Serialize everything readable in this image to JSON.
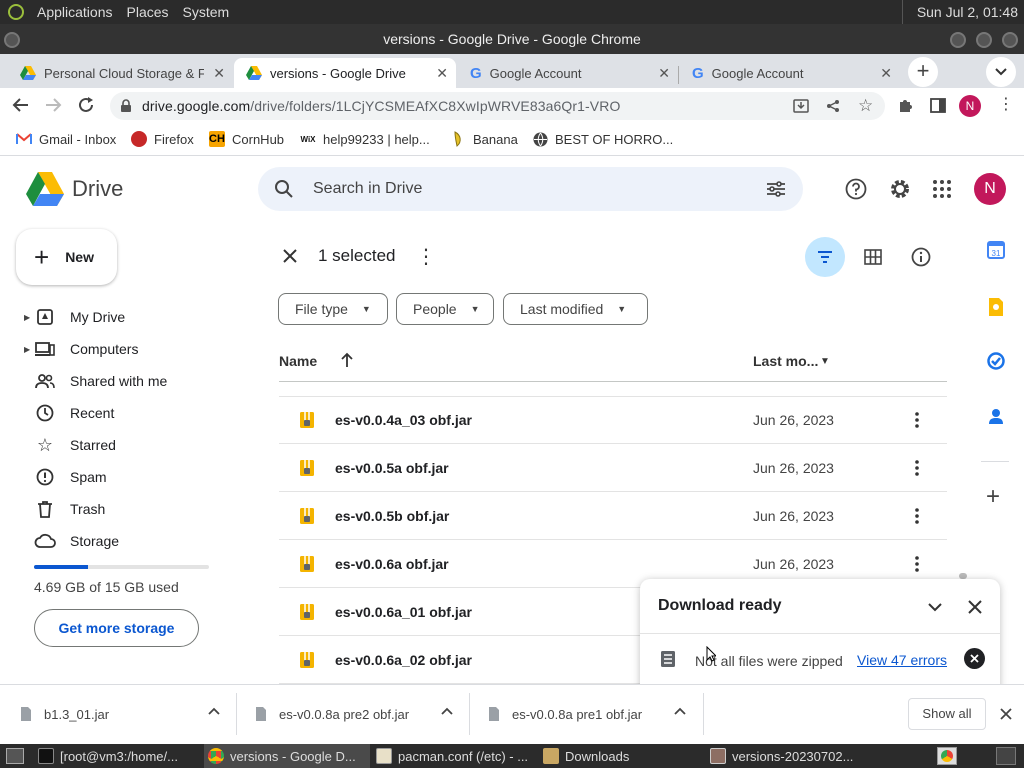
{
  "system": {
    "menus": [
      "Applications",
      "Places",
      "System"
    ],
    "clock": "Sun Jul  2, 01:48"
  },
  "window": {
    "title": "versions - Google Drive - Google Chrome"
  },
  "tabs": [
    {
      "label": "Personal Cloud Storage & F",
      "icon": "drive-icon"
    },
    {
      "label": "versions - Google Drive",
      "icon": "drive-icon",
      "active": true
    },
    {
      "label": "Google Account",
      "icon": "google-icon"
    },
    {
      "label": "Google Account",
      "icon": "google-icon"
    }
  ],
  "omnibox": {
    "host": "drive.google.com",
    "path": "/drive/folders/1LCjYCSMEAfXC8XwIpWRVE83a6Qr1-VRO"
  },
  "profile_initial": "N",
  "bookmarks": [
    {
      "label": "Gmail - Inbox",
      "icon": "gmail-icon"
    },
    {
      "label": "Firefox",
      "icon": "firefox-icon"
    },
    {
      "label": "CornHub",
      "icon": "ch-icon",
      "badge": "CH"
    },
    {
      "label": "help99233 | help...",
      "icon": "wix-icon",
      "badge": "WiX"
    },
    {
      "label": "Banana",
      "icon": "banana-icon"
    },
    {
      "label": "BEST OF HORRO...",
      "icon": "globe-icon"
    }
  ],
  "drive": {
    "logo_text": "Drive",
    "search_placeholder": "Search in Drive",
    "new_label": "New",
    "nav": [
      {
        "label": "My Drive",
        "icon": "my-drive-icon",
        "expandable": true
      },
      {
        "label": "Computers",
        "icon": "computers-icon",
        "expandable": true
      },
      {
        "label": "Shared with me",
        "icon": "shared-icon"
      },
      {
        "label": "Recent",
        "icon": "clock-icon"
      },
      {
        "label": "Starred",
        "icon": "star-icon"
      },
      {
        "label": "Spam",
        "icon": "spam-icon"
      },
      {
        "label": "Trash",
        "icon": "trash-icon"
      },
      {
        "label": "Storage",
        "icon": "cloud-icon"
      }
    ],
    "storage_used_fraction": 0.31,
    "storage_text": "4.69 GB of 15 GB used",
    "get_storage_label": "Get more storage",
    "selection_label": "1 selected",
    "filters": [
      "File type",
      "People",
      "Last modified"
    ],
    "col_name": "Name",
    "col_modified": "Last mo...",
    "files": [
      {
        "name": "es-v0.0.4a_03 obf.jar",
        "modified": "Jun 26, 2023"
      },
      {
        "name": "es-v0.0.5a obf.jar",
        "modified": "Jun 26, 2023"
      },
      {
        "name": "es-v0.0.5b obf.jar",
        "modified": "Jun 26, 2023"
      },
      {
        "name": "es-v0.0.6a obf.jar",
        "modified": "Jun 26, 2023"
      },
      {
        "name": "es-v0.0.6a_01 obf.jar",
        "modified": ""
      },
      {
        "name": "es-v0.0.6a_02 obf.jar",
        "modified": ""
      }
    ],
    "download_panel": {
      "title": "Download ready",
      "message": "Not all files were zipped",
      "link": "View 47 errors"
    }
  },
  "downloads": {
    "items": [
      "b1.3_01.jar",
      "es-v0.0.8a pre2 obf.jar",
      "es-v0.0.8a pre1 obf.jar"
    ],
    "show_all": "Show all"
  },
  "taskbar": [
    {
      "label": "[root@vm3:/home/...",
      "icon": "terminal-icon"
    },
    {
      "label": "versions - Google D...",
      "icon": "chrome-icon",
      "active": true
    },
    {
      "label": "pacman.conf (/etc) - ...",
      "icon": "editor-icon"
    },
    {
      "label": "Downloads",
      "icon": "folder-icon"
    },
    {
      "label": "versions-20230702...",
      "icon": "archive-icon"
    }
  ],
  "colors": {
    "accent": "#0b57d0",
    "profile": "#c2185b",
    "selected_bg": "#c2e7ff",
    "search_bg": "#edf2fa"
  }
}
